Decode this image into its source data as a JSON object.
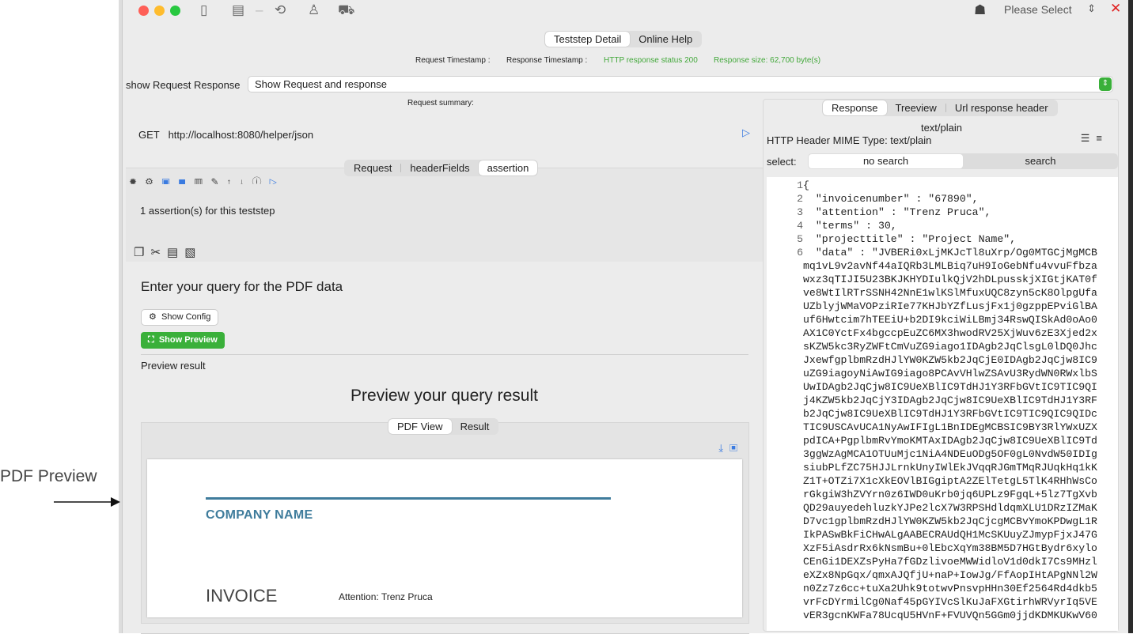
{
  "annotation": {
    "label": "PDF Preview"
  },
  "titlebar": {
    "please_select": "Please Select",
    "chevrons": "⇕",
    "close": "✕"
  },
  "colors": {
    "accent_green": "#3ab03a",
    "link_blue": "#3a7be0",
    "pdf_blue": "#3f7c9c",
    "close_red": "#e02020"
  },
  "top_tabs": [
    "Teststep Detail",
    "Online Help"
  ],
  "status": {
    "request_timestamp": "Request Timestamp :",
    "response_timestamp": "Response Timestamp :",
    "http_status": "HTTP response status 200",
    "response_size": "Response size: 62,700 byte(s)"
  },
  "request_response": {
    "label": "show Request Response",
    "selected": "Show Request and response"
  },
  "request": {
    "summary_label": "Request summary:",
    "method": "GET",
    "url": "http://localhost:8080/helper/json"
  },
  "request_tabs": [
    "Request",
    "headerFields",
    "assertion"
  ],
  "assertion": {
    "count_text": "1 assertion(s) for this teststep"
  },
  "query": {
    "title": "Enter your query for the PDF data",
    "show_config": "Show Config",
    "show_preview": "Show Preview",
    "preview_result_label": "Preview result",
    "preview_title": "Preview your query result"
  },
  "preview_tabs": [
    "PDF View",
    "Result"
  ],
  "pdf": {
    "company": "COMPANY NAME",
    "invoice": "INVOICE",
    "attention": "Attention: Trenz Pruca"
  },
  "response_tabs": [
    "Response",
    "Treeview",
    "Url response header"
  ],
  "response": {
    "mime_top": "text/plain",
    "mime_line": "HTTP Header MIME Type: text/plain",
    "select_label": "select:",
    "no_search": "no search",
    "search": "search"
  },
  "json_lines": [
    {
      "n": "1",
      "t": "{"
    },
    {
      "n": "2",
      "t": "  \"invoicenumber\" : \"67890\","
    },
    {
      "n": "3",
      "t": "  \"attention\" : \"Trenz Pruca\","
    },
    {
      "n": "4",
      "t": "  \"terms\" : 30,"
    },
    {
      "n": "5",
      "t": "  \"projecttitle\" : \"Project Name\","
    },
    {
      "n": "6",
      "t": "  \"data\" : \"JVBERi0xLjMKJcTl8uXrp/Og0MTGCjMgMCB"
    },
    {
      "n": "",
      "t": "mq1vL9v2avNf44aIQRb3LMLBiq7uH9IoGebNfu4vvuFfbza"
    },
    {
      "n": "",
      "t": "wxz3qTIJI5U23BKJKHYDIulkQjV2hDLpusskjXIGtjKAT0f"
    },
    {
      "n": "",
      "t": "ve8WtIlRTrSSNH42NnE1wlKSlMfuxUQC8zyn5cK8OlpgUfa"
    },
    {
      "n": "",
      "t": "UZblyjWMaVOPziRIe77KHJbYZfLusjFx1j0gzppEPviGlBA"
    },
    {
      "n": "",
      "t": "uf6Hwtcim7hTEEiU+b2DI9kciWiLBmj34RswQISkAd0oAo0"
    },
    {
      "n": "",
      "t": "AX1C0YctFx4bgccpEuZC6MX3hwodRV25XjWuv6zE3Xjed2x"
    },
    {
      "n": "",
      "t": "sKZW5kc3RyZWFtCmVuZG9iago1IDAgb2JqClsgL0lDQ0Jhc"
    },
    {
      "n": "",
      "t": "JxewfgplbmRzdHJlYW0KZW5kb2JqCjE0IDAgb2JqCjw8IC9"
    },
    {
      "n": "",
      "t": "uZG9iagoyNiAwIG9iago8PCAvVHlwZSAvU3RydWN0RWxlbS"
    },
    {
      "n": "",
      "t": "UwIDAgb2JqCjw8IC9UeXBlIC9TdHJ1Y3RFbGVtIC9TIC9QI"
    },
    {
      "n": "",
      "t": "j4KZW5kb2JqCjY3IDAgb2JqCjw8IC9UeXBlIC9TdHJ1Y3RF"
    },
    {
      "n": "",
      "t": "b2JqCjw8IC9UeXBlIC9TdHJ1Y3RFbGVtIC9TIC9QIC9QIDc"
    },
    {
      "n": "",
      "t": "TIC9USCAvUCA1NyAwIFIgL1BnIDEgMCBSIC9BY3RlYWxUZX"
    },
    {
      "n": "",
      "t": "pdICA+PgplbmRvYmoKMTAxIDAgb2JqCjw8IC9UeXBlIC9Td"
    },
    {
      "n": "",
      "t": "3ggWzAgMCA1OTUuMjc1NiA4NDEuODg5OF0gL0NvdW50IDIg"
    },
    {
      "n": "",
      "t": "siubPLfZC75HJJLrnkUnyIWlEkJVqqRJGmTMqRJUqkHq1kK"
    },
    {
      "n": "",
      "t": "Z1T+OTZi7X1cXkEOVlBIGgiptA2ZElTetgL5TlK4RHhWsCo"
    },
    {
      "n": "",
      "t": "rGkgiW3hZVYrn0z6IWD0uKrb0jq6UPLz9FgqL+5lz7TgXvb"
    },
    {
      "n": "",
      "t": "QD29auyedehluzkYJPe2lcX7W3RPSHdldqmXLU1DRzIZMaK"
    },
    {
      "n": "",
      "t": "D7vc1gplbmRzdHJlYW0KZW5kb2JqCjcgMCBvYmoKPDwgL1R"
    },
    {
      "n": "",
      "t": "IkPASwBkFiCHwALgAABECRAUdQH1McSKUuyZJmypFjxJ47G"
    },
    {
      "n": "",
      "t": "XzF5iAsdrRx6kNsmBu+0lEbcXqYm38BM5D7HGtBydr6xylo"
    },
    {
      "n": "",
      "t": "CEnGi1DEXZsPyHa7fGDzlivoeMWWidloV1d0dkI7Cs9MHzl"
    },
    {
      "n": "",
      "t": "eXZx8NpGqx/qmxAJQfjU+naP+IowJg/FfAopIHtAPgNNl2W"
    },
    {
      "n": "",
      "t": "n0Zz7z6cc+tuXa2Uhk9totwvPnsvpHHn30Ef2564Rd4dkb5"
    },
    {
      "n": "",
      "t": "vrFcDYrmilCg0Naf45pGYIVcSlKuJaFXGtirhWRVyrIq5VE"
    },
    {
      "n": "",
      "t": "vER3gcnKWFa78UcqU5HVnF+FVUVQn5GGm0jjdKDMKUKwV60"
    }
  ]
}
